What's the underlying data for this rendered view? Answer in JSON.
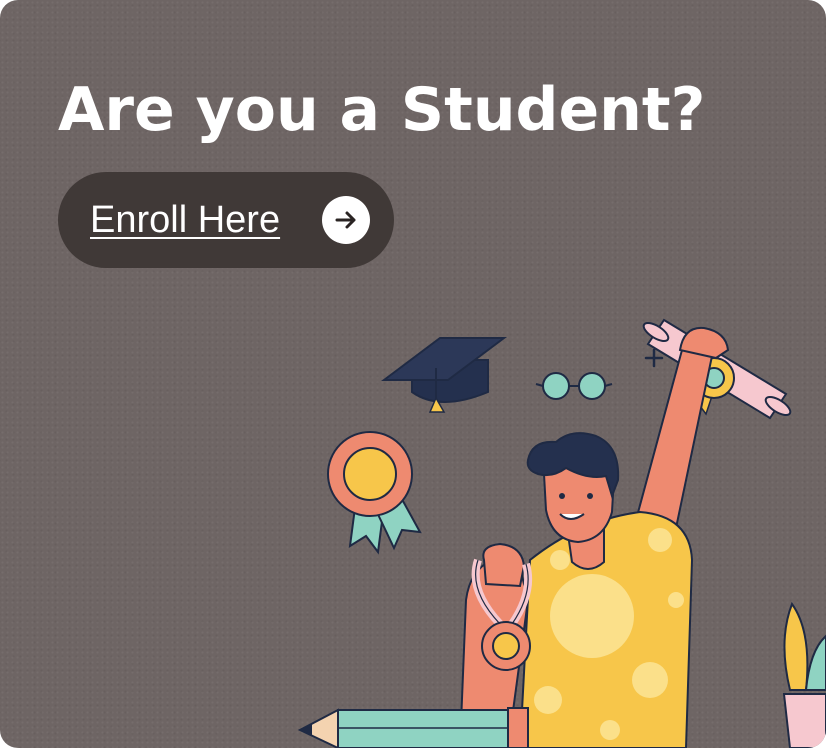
{
  "banner": {
    "headline": "Are you a Student?",
    "cta_label": "Enroll Here",
    "cta_icon": "arrow-right-icon"
  },
  "colors": {
    "background": "#6e6564",
    "button_background": "#403937",
    "text": "#ffffff",
    "accent_yellow": "#f7c64a",
    "accent_orange": "#ee8a70",
    "accent_teal": "#8fd3c2",
    "outline": "#1f2a44"
  },
  "illustration": {
    "items": [
      "graduation-cap-icon",
      "glasses-icon",
      "rosette-medal-icon",
      "diploma-scroll-icon",
      "student-figure",
      "neck-medal-icon",
      "pencil-icon",
      "potted-plant-icon",
      "sparkle-icon"
    ]
  }
}
